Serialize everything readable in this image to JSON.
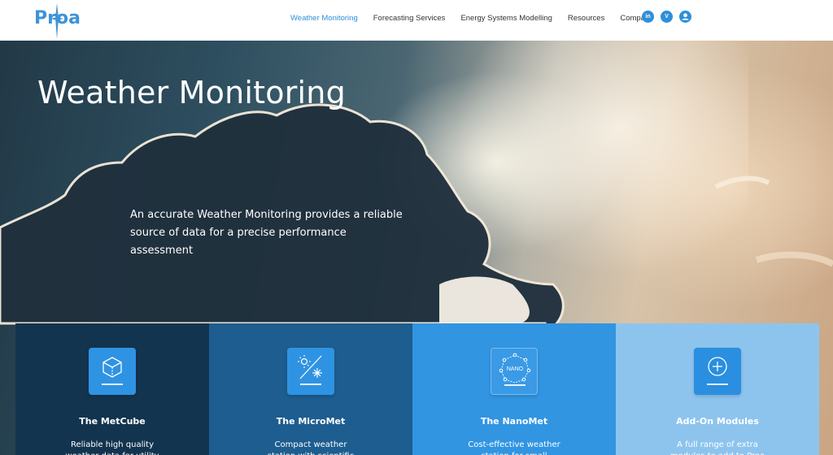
{
  "brand": {
    "logo_text": "Proa",
    "accent": "#2f8fd8"
  },
  "nav": {
    "items": [
      {
        "label": "Weather Monitoring",
        "active": true
      },
      {
        "label": "Forecasting Services",
        "active": false
      },
      {
        "label": "Energy Systems Modelling",
        "active": false
      },
      {
        "label": "Resources",
        "active": false
      },
      {
        "label": "Company",
        "active": false
      }
    ],
    "socials": [
      {
        "icon": "linkedin-icon",
        "glyph": "in"
      },
      {
        "icon": "vimeo-icon",
        "glyph": "V"
      },
      {
        "icon": "user-account-icon",
        "glyph": ""
      }
    ]
  },
  "hero": {
    "title": "Weather Monitoring",
    "subtitle": "An accurate Weather Monitoring provides a reliable source of data for a precise performance assessment"
  },
  "cards": [
    {
      "title": "The MetCube",
      "desc": "Reliable high quality weather data for utility",
      "icon": "cube-icon"
    },
    {
      "title": "The MicroMet",
      "desc": "Compact weather station with scientific",
      "icon": "sun-snow-icon"
    },
    {
      "title": "The NanoMet",
      "desc": "Cost-effective weather station for small",
      "icon": "nano-icon"
    },
    {
      "title": "Add-On Modules",
      "desc": "A full range of extra modules to add to Proa",
      "icon": "plus-circle-icon"
    }
  ],
  "icon_labels": {
    "nano": "NANO"
  }
}
